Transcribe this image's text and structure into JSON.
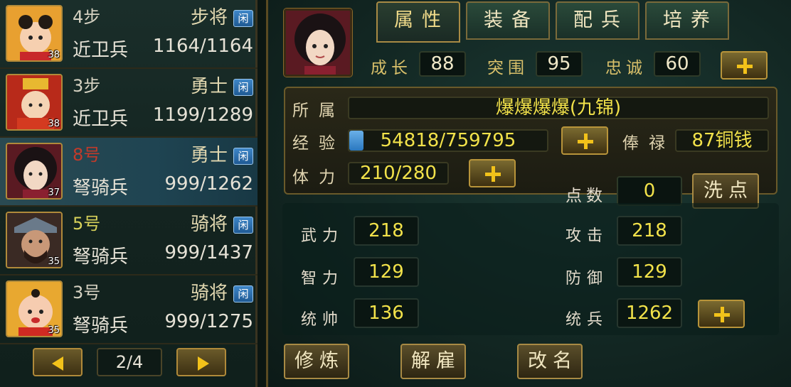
{
  "roster": [
    {
      "name": "4步",
      "rank": "步将",
      "status": "闲",
      "unit": "近卫兵",
      "hp": "1164/1164",
      "level": "38",
      "name_color": "default"
    },
    {
      "name": "3步",
      "rank": "勇士",
      "status": "闲",
      "unit": "近卫兵",
      "hp": "1199/1289",
      "level": "38",
      "name_color": "default"
    },
    {
      "name": "8号",
      "rank": "勇士",
      "status": "闲",
      "unit": "弩骑兵",
      "hp": "999/1262",
      "level": "37",
      "name_color": "red"
    },
    {
      "name": "5号",
      "rank": "骑将",
      "status": "闲",
      "unit": "弩骑兵",
      "hp": "999/1437",
      "level": "35",
      "name_color": "yellow"
    },
    {
      "name": "3号",
      "rank": "骑将",
      "status": "闲",
      "unit": "弩骑兵",
      "hp": "999/1275",
      "level": "35",
      "name_color": "default"
    }
  ],
  "pager": {
    "page": "2/4"
  },
  "tabs": [
    "属性",
    "装备",
    "配兵",
    "培养"
  ],
  "growth": {
    "growth_label": "成长",
    "growth_value": "88",
    "breakout_label": "突围",
    "breakout_value": "95",
    "loyalty_label": "忠诚",
    "loyalty_value": "60"
  },
  "info": {
    "owner_label": "所属",
    "owner_value": "爆爆爆爆(九锦)",
    "exp_label": "经验",
    "exp_value": "54818/759795",
    "exp_fraction": 0.072,
    "salary_label": "俸禄",
    "salary_value": "87铜钱",
    "stamina_label": "体力",
    "stamina_value": "210/280"
  },
  "points": {
    "label": "点数",
    "value": "0",
    "wash_label": "洗点"
  },
  "attributes": {
    "force_label": "武力",
    "force_value": "218",
    "intel_label": "智力",
    "intel_value": "129",
    "command_label": "统帅",
    "command_value": "136",
    "attack_label": "攻击",
    "attack_value": "218",
    "defense_label": "防御",
    "defense_value": "129",
    "troops_label": "统兵",
    "troops_value": "1262"
  },
  "actions": {
    "train": "修炼",
    "dismiss": "解雇",
    "rename": "改名"
  },
  "colors": {
    "gold": "#f2c21a",
    "panel": "#122622",
    "selected_row": "#1f4452"
  }
}
